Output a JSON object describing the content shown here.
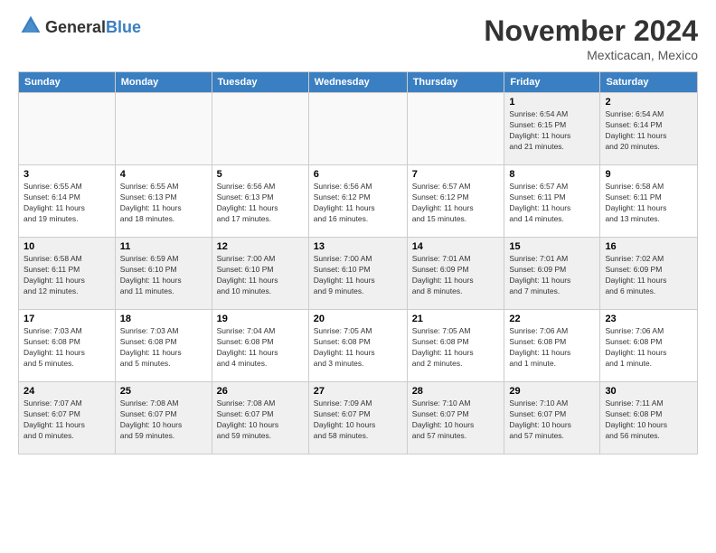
{
  "logo": {
    "general": "General",
    "blue": "Blue"
  },
  "header": {
    "month": "November 2024",
    "location": "Mexticacan, Mexico"
  },
  "weekdays": [
    "Sunday",
    "Monday",
    "Tuesday",
    "Wednesday",
    "Thursday",
    "Friday",
    "Saturday"
  ],
  "weeks": [
    [
      {
        "day": "",
        "info": ""
      },
      {
        "day": "",
        "info": ""
      },
      {
        "day": "",
        "info": ""
      },
      {
        "day": "",
        "info": ""
      },
      {
        "day": "",
        "info": ""
      },
      {
        "day": "1",
        "info": "Sunrise: 6:54 AM\nSunset: 6:15 PM\nDaylight: 11 hours\nand 21 minutes."
      },
      {
        "day": "2",
        "info": "Sunrise: 6:54 AM\nSunset: 6:14 PM\nDaylight: 11 hours\nand 20 minutes."
      }
    ],
    [
      {
        "day": "3",
        "info": "Sunrise: 6:55 AM\nSunset: 6:14 PM\nDaylight: 11 hours\nand 19 minutes."
      },
      {
        "day": "4",
        "info": "Sunrise: 6:55 AM\nSunset: 6:13 PM\nDaylight: 11 hours\nand 18 minutes."
      },
      {
        "day": "5",
        "info": "Sunrise: 6:56 AM\nSunset: 6:13 PM\nDaylight: 11 hours\nand 17 minutes."
      },
      {
        "day": "6",
        "info": "Sunrise: 6:56 AM\nSunset: 6:12 PM\nDaylight: 11 hours\nand 16 minutes."
      },
      {
        "day": "7",
        "info": "Sunrise: 6:57 AM\nSunset: 6:12 PM\nDaylight: 11 hours\nand 15 minutes."
      },
      {
        "day": "8",
        "info": "Sunrise: 6:57 AM\nSunset: 6:11 PM\nDaylight: 11 hours\nand 14 minutes."
      },
      {
        "day": "9",
        "info": "Sunrise: 6:58 AM\nSunset: 6:11 PM\nDaylight: 11 hours\nand 13 minutes."
      }
    ],
    [
      {
        "day": "10",
        "info": "Sunrise: 6:58 AM\nSunset: 6:11 PM\nDaylight: 11 hours\nand 12 minutes."
      },
      {
        "day": "11",
        "info": "Sunrise: 6:59 AM\nSunset: 6:10 PM\nDaylight: 11 hours\nand 11 minutes."
      },
      {
        "day": "12",
        "info": "Sunrise: 7:00 AM\nSunset: 6:10 PM\nDaylight: 11 hours\nand 10 minutes."
      },
      {
        "day": "13",
        "info": "Sunrise: 7:00 AM\nSunset: 6:10 PM\nDaylight: 11 hours\nand 9 minutes."
      },
      {
        "day": "14",
        "info": "Sunrise: 7:01 AM\nSunset: 6:09 PM\nDaylight: 11 hours\nand 8 minutes."
      },
      {
        "day": "15",
        "info": "Sunrise: 7:01 AM\nSunset: 6:09 PM\nDaylight: 11 hours\nand 7 minutes."
      },
      {
        "day": "16",
        "info": "Sunrise: 7:02 AM\nSunset: 6:09 PM\nDaylight: 11 hours\nand 6 minutes."
      }
    ],
    [
      {
        "day": "17",
        "info": "Sunrise: 7:03 AM\nSunset: 6:08 PM\nDaylight: 11 hours\nand 5 minutes."
      },
      {
        "day": "18",
        "info": "Sunrise: 7:03 AM\nSunset: 6:08 PM\nDaylight: 11 hours\nand 5 minutes."
      },
      {
        "day": "19",
        "info": "Sunrise: 7:04 AM\nSunset: 6:08 PM\nDaylight: 11 hours\nand 4 minutes."
      },
      {
        "day": "20",
        "info": "Sunrise: 7:05 AM\nSunset: 6:08 PM\nDaylight: 11 hours\nand 3 minutes."
      },
      {
        "day": "21",
        "info": "Sunrise: 7:05 AM\nSunset: 6:08 PM\nDaylight: 11 hours\nand 2 minutes."
      },
      {
        "day": "22",
        "info": "Sunrise: 7:06 AM\nSunset: 6:08 PM\nDaylight: 11 hours\nand 1 minute."
      },
      {
        "day": "23",
        "info": "Sunrise: 7:06 AM\nSunset: 6:08 PM\nDaylight: 11 hours\nand 1 minute."
      }
    ],
    [
      {
        "day": "24",
        "info": "Sunrise: 7:07 AM\nSunset: 6:07 PM\nDaylight: 11 hours\nand 0 minutes."
      },
      {
        "day": "25",
        "info": "Sunrise: 7:08 AM\nSunset: 6:07 PM\nDaylight: 10 hours\nand 59 minutes."
      },
      {
        "day": "26",
        "info": "Sunrise: 7:08 AM\nSunset: 6:07 PM\nDaylight: 10 hours\nand 59 minutes."
      },
      {
        "day": "27",
        "info": "Sunrise: 7:09 AM\nSunset: 6:07 PM\nDaylight: 10 hours\nand 58 minutes."
      },
      {
        "day": "28",
        "info": "Sunrise: 7:10 AM\nSunset: 6:07 PM\nDaylight: 10 hours\nand 57 minutes."
      },
      {
        "day": "29",
        "info": "Sunrise: 7:10 AM\nSunset: 6:07 PM\nDaylight: 10 hours\nand 57 minutes."
      },
      {
        "day": "30",
        "info": "Sunrise: 7:11 AM\nSunset: 6:08 PM\nDaylight: 10 hours\nand 56 minutes."
      }
    ]
  ]
}
